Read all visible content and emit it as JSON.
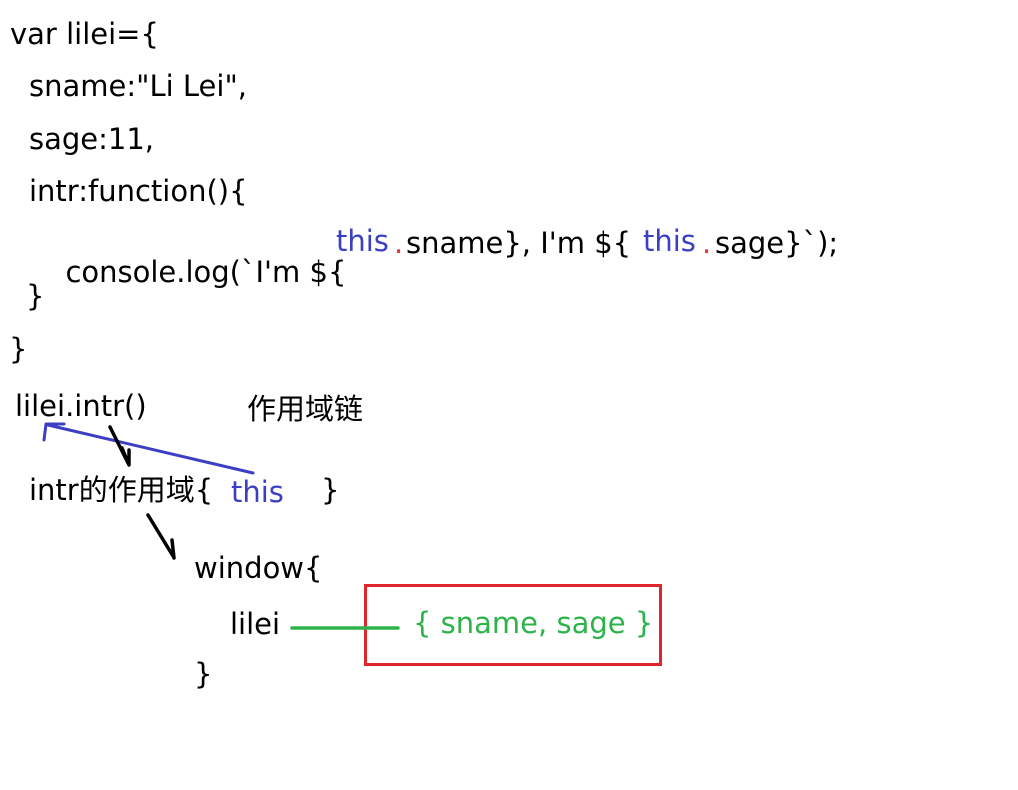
{
  "code": {
    "line1": "var lilei={",
    "line2": "sname:\"Li Lei\",",
    "line3": "sage:11,",
    "line4": "intr:function(){",
    "line5_start": "console.log(`I'm ${",
    "line5_this1": "this",
    "line5_dot1": ".",
    "line5_mid": "sname}, I'm ${",
    "line5_this2": "this",
    "line5_dot2": ".",
    "line5_end": "sage}`);",
    "line6": "}",
    "line7": "}"
  },
  "annotations": {
    "call": "lilei.intr()",
    "scope_chain": "作用域链",
    "intr_scope": "intr的作用域{",
    "intr_this": "this",
    "intr_close": "}",
    "window_open": "window{",
    "lilei_var": "lilei",
    "object_value": "{ sname, sage }",
    "window_close": "}"
  },
  "colors": {
    "this_blue": "#3a3fc4",
    "dot_red": "#e33535",
    "object_green": "#2db34a",
    "box_red": "#e0262d",
    "arrow_black": "#000000"
  }
}
